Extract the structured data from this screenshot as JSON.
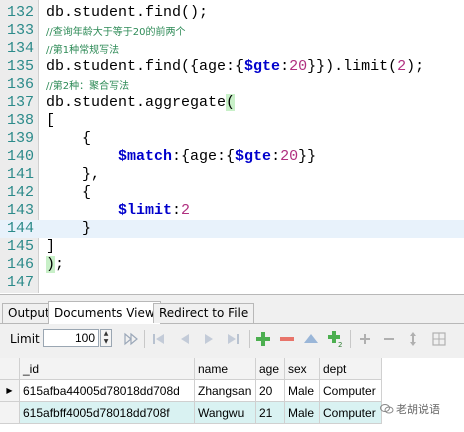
{
  "editor": {
    "lines": [
      {
        "n": "132",
        "code": "db.student.find();"
      },
      {
        "n": "133",
        "comment": "//查询年龄大于等于20的前两个"
      },
      {
        "n": "134",
        "comment": "//第1种常规写法"
      },
      {
        "n": "135",
        "code": "db.student.find({age:{$gte:20}}).limit(2);"
      },
      {
        "n": "136",
        "comment": "//第2种：聚合写法"
      },
      {
        "n": "137",
        "code": "db.student.aggregate("
      },
      {
        "n": "138",
        "code": "["
      },
      {
        "n": "139",
        "code": "    {"
      },
      {
        "n": "140",
        "code": "        $match:{age:{$gte:20}}"
      },
      {
        "n": "141",
        "code": "    },"
      },
      {
        "n": "142",
        "code": "    {"
      },
      {
        "n": "143",
        "code": "        $limit:2"
      },
      {
        "n": "144",
        "code": "    }"
      },
      {
        "n": "145",
        "code": "]"
      },
      {
        "n": "146",
        "code": ");"
      },
      {
        "n": "147",
        "code": ""
      }
    ]
  },
  "tabs": [
    "Output",
    "Documents View",
    "Redirect to File"
  ],
  "toolbar": {
    "limit_label": "Limit",
    "limit_value": "100",
    "icons": [
      "fast-forward-icon",
      "first-page-icon",
      "prev-page-icon",
      "next-page-icon",
      "last-page-icon",
      "add-icon",
      "remove-icon",
      "up-icon",
      "add-two-icon",
      "add-small-icon",
      "remove-small-icon",
      "arrows-icon",
      "grid-icon"
    ]
  },
  "grid": {
    "columns": [
      "_id",
      "name",
      "age",
      "sex",
      "dept"
    ],
    "rows": [
      [
        "615afba44005d78018dd708d",
        "Zhangsan",
        "20",
        "Male",
        "Computer"
      ],
      [
        "615afbff4005d78018dd708f",
        "Wangwu",
        "21",
        "Male",
        "Computer"
      ]
    ]
  },
  "watermark": "老胡说语",
  "colors": {
    "line_numbers": "#2b8a8a",
    "comment": "#2e8b57",
    "number": "#b03080",
    "operator": "#0000cc",
    "selected_row": "#d9f2f2"
  }
}
